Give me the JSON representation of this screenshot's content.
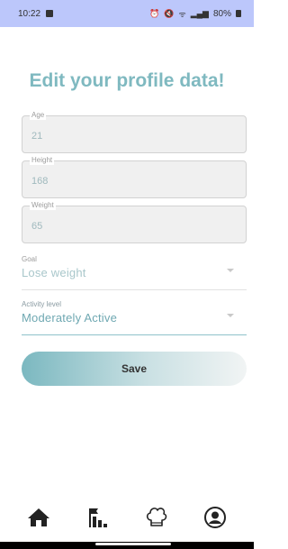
{
  "status_bar": {
    "time": "10:22",
    "battery": "80%"
  },
  "page": {
    "title": "Edit your profile data!"
  },
  "fields": {
    "age": {
      "label": "Age",
      "value": "21"
    },
    "height": {
      "label": "Height",
      "value": "168"
    },
    "weight": {
      "label": "Weight",
      "value": "65"
    }
  },
  "dropdowns": {
    "goal": {
      "label": "Goal",
      "value": "Lose weight"
    },
    "activity": {
      "label": "Activity level",
      "value": "Moderately Active"
    }
  },
  "actions": {
    "save_label": "Save"
  },
  "nav": {
    "items": [
      "home-icon",
      "leaderboard-icon",
      "chef-hat-icon",
      "profile-icon"
    ]
  },
  "colors": {
    "accent": "#7fb9c0",
    "status_bar": "#bcc7fb"
  }
}
